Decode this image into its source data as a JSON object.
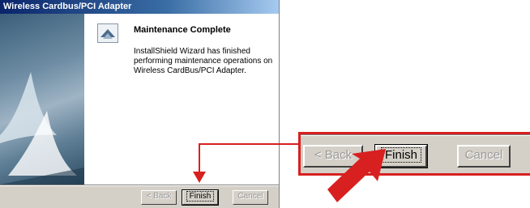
{
  "window": {
    "title": "Wireless Cardbus/PCI Adapter"
  },
  "wizard": {
    "heading": "Maintenance Complete",
    "message": "InstallShield Wizard has finished performing maintenance operations on Wireless CardBus/PCI Adapter."
  },
  "buttons": {
    "back": "< Back",
    "finish": "Finish",
    "cancel": "Cancel"
  },
  "zoom_buttons": {
    "back": "< Back",
    "finish": "Finish",
    "cancel": "Cancel"
  },
  "colors": {
    "highlight": "#d82020",
    "titlebar": "#0a246a",
    "dialog_bg": "#d4d0c8"
  },
  "icons": {
    "wizard_logo": "installshield-wizard-icon",
    "pointer": "arrow-icon"
  }
}
